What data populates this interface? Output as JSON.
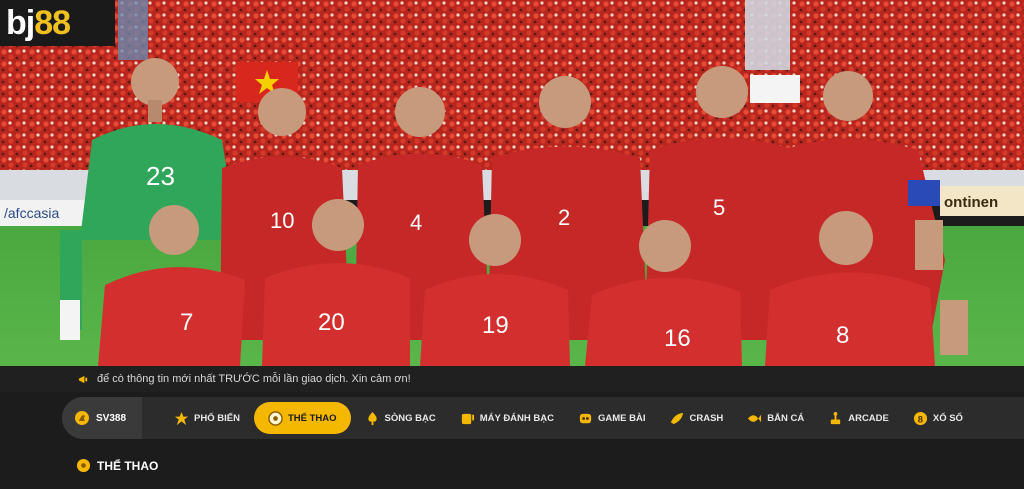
{
  "brand": {
    "logo_part1": "bj",
    "logo_part2": "88"
  },
  "hero": {
    "banner_left": "/afccasia",
    "banner_right": "ontinen",
    "players_back": [
      "23",
      "10",
      "4",
      "2",
      "5"
    ],
    "players_front": [
      "7",
      "20",
      "19",
      "16",
      "8"
    ]
  },
  "ticker": {
    "text": "để cò thông tin mới nhất TRƯỚC mỗi lần giao dịch. Xin cảm ơn!"
  },
  "nav": {
    "site_label": "SV388",
    "items": [
      {
        "label": "PHỔ BIẾN",
        "icon": "star-icon"
      },
      {
        "label": "THỂ THAO",
        "icon": "ball-icon"
      },
      {
        "label": "SÒNG BẠC",
        "icon": "spade-icon"
      },
      {
        "label": "MÁY ĐÁNH BẠC",
        "icon": "slot-icon"
      },
      {
        "label": "GAME BÀI",
        "icon": "cards-icon"
      },
      {
        "label": "CRASH",
        "icon": "rocket-icon"
      },
      {
        "label": "BẮN CÁ",
        "icon": "fish-icon"
      },
      {
        "label": "ARCADE",
        "icon": "arcade-icon"
      },
      {
        "label": "XỔ SỐ",
        "icon": "lottery-icon"
      }
    ]
  },
  "section": {
    "title": "THỂ THAO"
  },
  "colors": {
    "accent": "#f5b800",
    "background": "#1c1c1c",
    "nav_bg": "#2c2c2c"
  }
}
